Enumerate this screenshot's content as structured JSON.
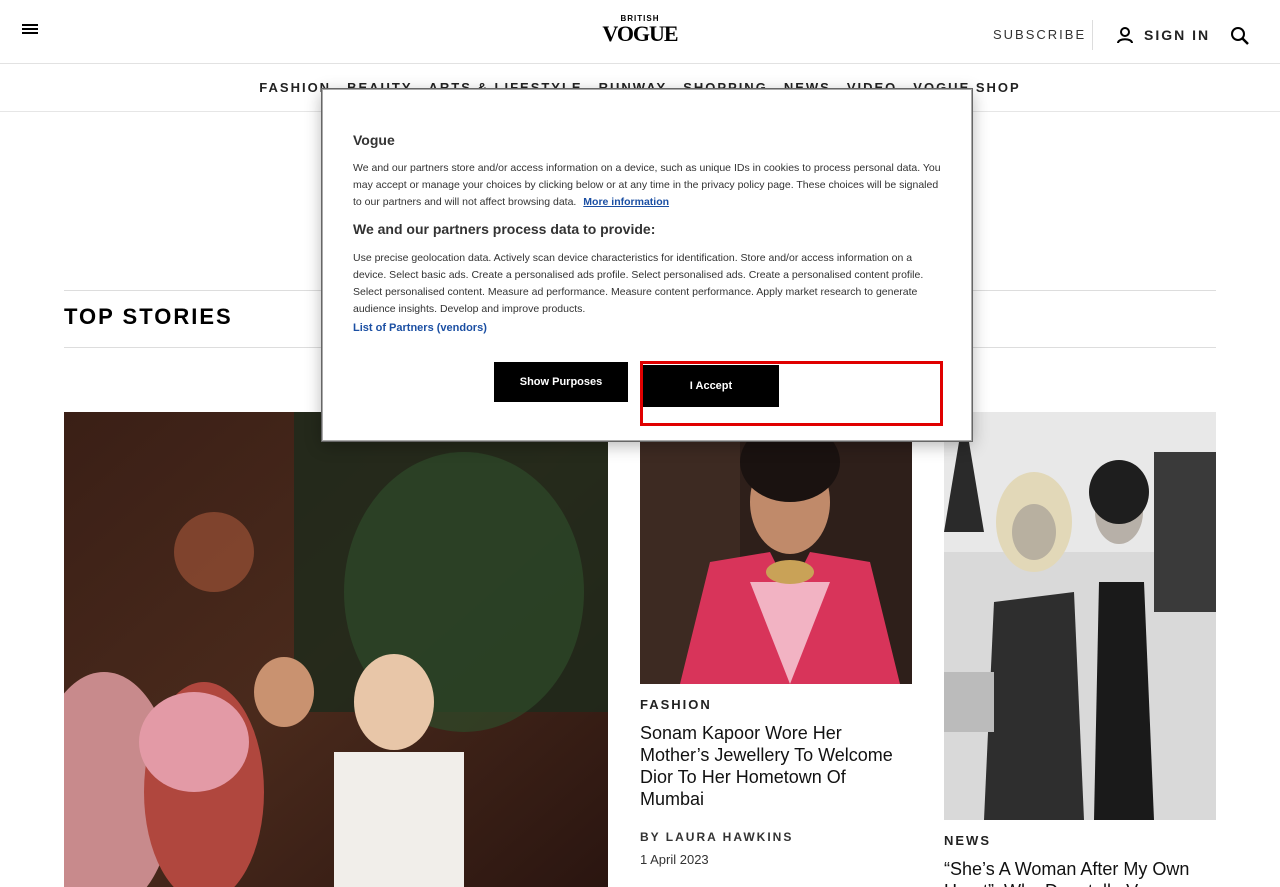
{
  "header": {
    "logo_small": "BRITISH",
    "logo_big": "VOGUE",
    "subscribe": "SUBSCRIBE",
    "sign_in": "SIGN IN"
  },
  "nav": {
    "items": [
      "FASHION",
      "BEAUTY",
      "ARTS & LIFESTYLE",
      "RUNWAY",
      "SHOPPING",
      "NEWS",
      "VIDEO",
      "VOGUE SHOP"
    ]
  },
  "top_stories": {
    "title": "TOP STORIES",
    "cards": [
      {
        "rubric": "FASHION",
        "headline": "Sonam Kapoor Wore Her Mother’s Jewellery To Welcome Dior To Her Hometown Of Mumbai",
        "byline": "BY LAURA HAWKINS",
        "date": "1 April 2023"
      },
      {
        "rubric": "NEWS",
        "headline": "“She’s A Woman After My Own Heart”: Why Donatella Versace..."
      }
    ]
  },
  "consent": {
    "title": "Vogue",
    "paragraph1": "We and our partners store and/or access information on a device, such as unique IDs in cookies to process personal data. You may accept or manage your choices by clicking below or at any time in the privacy policy page. These choices will be signaled to our partners and will not affect browsing data.",
    "more_info": "More information",
    "subtitle": "We and our partners process data to provide:",
    "paragraph2": "Use precise geolocation data. Actively scan device characteristics for identification. Store and/or access information on a device. Select basic ads. Create a personalised ads profile. Select personalised ads. Create a personalised content profile. Select personalised content. Measure ad performance. Measure content performance. Apply market research to generate audience insights. Develop and improve products.",
    "partners_link": "List of Partners (vendors)",
    "show_purposes": "Show Purposes",
    "accept": "I Accept"
  },
  "colors": {
    "highlight": "#e00000",
    "link": "#1b4fa3"
  }
}
